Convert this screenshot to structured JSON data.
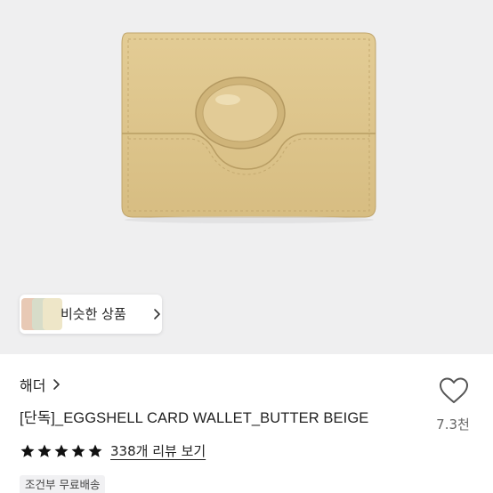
{
  "product": {
    "brand": "해더",
    "title": "[단독]_EGGSHELL CARD WALLET_BUTTER BEIGE",
    "like_count": "7.3천",
    "rating_stars": 5,
    "reviews_link": "338개 리뷰 보기",
    "shipping_badge": "조건부 무료배송"
  },
  "similar": {
    "label": "비슷한 상품"
  },
  "icons": {
    "brand_chevron": "chevron-right-icon",
    "similar_chevron": "chevron-right-icon",
    "like": "heart-outline-icon",
    "star": "star-filled-icon"
  },
  "colors": {
    "hero_background": "#efeff0",
    "wallet": "#dcc389",
    "star": "#111111"
  }
}
